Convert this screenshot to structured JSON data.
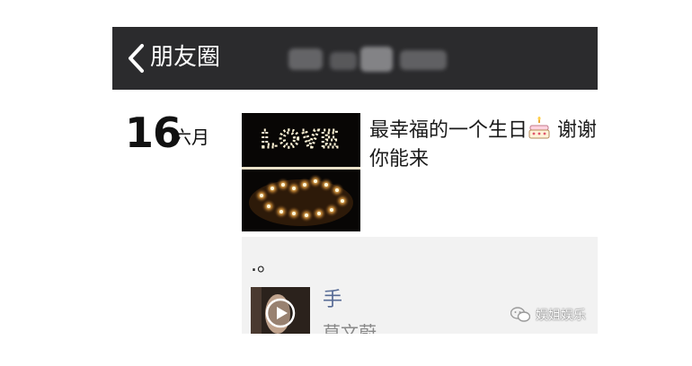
{
  "navbar": {
    "back_icon": "chevron-left-icon",
    "title": "朋友圈"
  },
  "post": {
    "date_day": "16",
    "date_month": "六月",
    "photo_text": "LOVE",
    "text_part1": "最幸福的一个生日",
    "text_part2": "谢谢你能来",
    "emoji": "cake-icon"
  },
  "shared_item": {
    "caption": ".。",
    "title": "手",
    "subtitle": "莫文蔚",
    "thumb_icon": "play-icon"
  },
  "watermark": {
    "text": "娱姐娱乐",
    "icon": "wechat-icon"
  },
  "colors": {
    "navbar": "#2b2b2d",
    "link": "#576b95",
    "card": "#f2f2f2"
  }
}
